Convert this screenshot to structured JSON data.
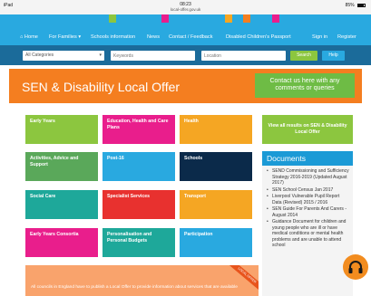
{
  "status_bar": {
    "carrier": "iPad",
    "time": "08:23",
    "url": "local-offer.gov.uk",
    "battery": "85%"
  },
  "nav": {
    "items": [
      {
        "label": "⌂ Home"
      },
      {
        "label": "For Families ▾"
      },
      {
        "label": "Schools information"
      },
      {
        "label": "News"
      },
      {
        "label": "Contact / Feedback"
      },
      {
        "label": "Disabled Children's Passport"
      },
      {
        "label": "Sign in"
      },
      {
        "label": "Register"
      }
    ]
  },
  "search": {
    "category_value": "All Categories",
    "keywords_placeholder": "Keywords",
    "location_placeholder": "Location",
    "search_label": "Search",
    "help_label": "Help"
  },
  "banner": {
    "title": "SEN & Disability Local Offer",
    "contact_label": "Contact us here with any comments or queries"
  },
  "tiles": [
    {
      "label": "Early Years",
      "color": "#8cc63f"
    },
    {
      "label": "Education, Health and Care Plans",
      "color": "#e91e8c"
    },
    {
      "label": "Health",
      "color": "#f5a623"
    },
    {
      "label": "Activities, Advice and Support",
      "color": "#5aa85a"
    },
    {
      "label": "Post-16",
      "color": "#29a9e0"
    },
    {
      "label": "Schools",
      "color": "#0b2a4a"
    },
    {
      "label": "Social Care",
      "color": "#1ea89a"
    },
    {
      "label": "Specialist Services",
      "color": "#e8312f"
    },
    {
      "label": "Transport",
      "color": "#f5a623"
    },
    {
      "label": "Early Years Consortia",
      "color": "#e91e8c"
    },
    {
      "label": "Personalisation and Personal Budgets",
      "color": "#1ea89a"
    },
    {
      "label": "Participation",
      "color": "#29a9e0"
    }
  ],
  "sidebar": {
    "all_results_label": "View all results on SEN & Disability Local Offer",
    "documents_title": "Documents",
    "documents": [
      "SEND Commissioning and Sufficiency Strategy 2016-2019 (Updated August 2017)",
      "SEN School Census Jan 2017",
      "Liverpool Vulnerable Pupil Report Data (Revised) 2015 / 2016",
      "SEN Guide For Parents And Carers - August 2014",
      "Guidance Document for children and young people who are ill or have medical conditions or mental health problems and are unable to attend school"
    ]
  },
  "offer": {
    "ribbon": "LOCAL OFFER",
    "text": "All councils in England have to publish a Local Offer to provide information about services that are available"
  },
  "colors": {
    "nav_blue": "#29a9e0",
    "search_bar": "#1b6b9a",
    "banner_orange": "#f47e20",
    "contact_green": "#6ebc45",
    "docs_header": "#1b9ad6"
  }
}
